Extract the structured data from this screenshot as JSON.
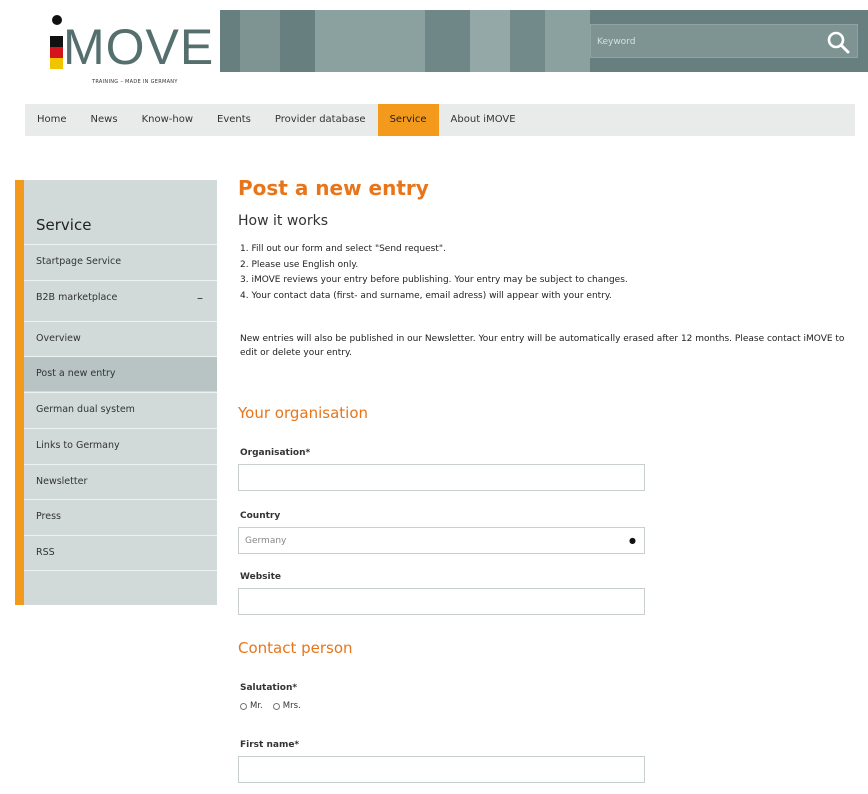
{
  "header": {
    "logo_text": "iMOVE",
    "tagline": "TRAINING – MADE IN GERMANY",
    "search_placeholder": "Keyword",
    "colors": {
      "banner": "#67807f",
      "accent": "#f39a1d",
      "title": "#e8751a"
    }
  },
  "nav": {
    "items": [
      {
        "label": "Home"
      },
      {
        "label": "News"
      },
      {
        "label": "Know-how"
      },
      {
        "label": "Events"
      },
      {
        "label": "Provider database"
      },
      {
        "label": "Service"
      },
      {
        "label": "About iMOVE"
      }
    ],
    "active": "Service"
  },
  "sidebar": {
    "title": "Service",
    "items": [
      {
        "label": "Startpage Service"
      },
      {
        "label": "B2B marketplace",
        "toggle": "–"
      },
      {
        "label": "Overview"
      },
      {
        "label": "Post a new entry"
      },
      {
        "label": "German dual system"
      },
      {
        "label": "Links to Germany"
      },
      {
        "label": "Newsletter"
      },
      {
        "label": "Press"
      },
      {
        "label": "RSS"
      }
    ],
    "active": "Post a new entry"
  },
  "main": {
    "page_title": "Post a new entry",
    "how_title": "How it works",
    "steps": [
      "1. Fill out our form and select \"Send request\".",
      "2. Please use English only.",
      "3. iMOVE reviews your entry before publishing. Your entry may be subject to changes.",
      "4. Your contact data (first- and surname, email adress) will appear with your entry."
    ],
    "note": "New entries will also be published in our Newsletter. Your entry will be automatically erased after 12 months. Please contact iMOVE to edit or delete your entry."
  },
  "form": {
    "organisation_section": "Your organisation",
    "organisation_label": "Organisation*",
    "organisation_value": "",
    "country_label": "Country",
    "country_value": "Germany",
    "website_label": "Website",
    "website_value": "",
    "contact_section": "Contact person",
    "salutation_label": "Salutation*",
    "salutation_options": [
      "Mr.",
      "Mrs."
    ],
    "first_name_label": "First name*",
    "first_name_value": ""
  }
}
